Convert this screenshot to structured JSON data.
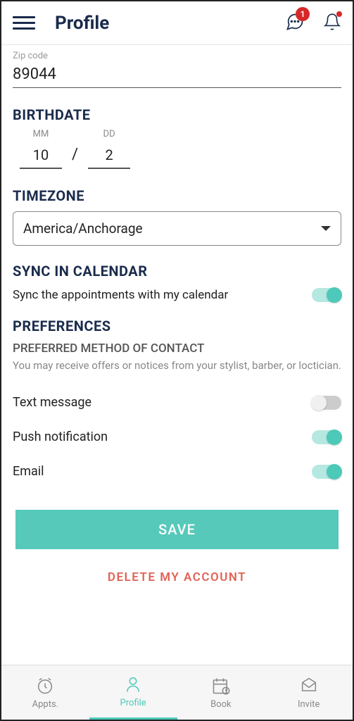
{
  "header": {
    "title": "Profile",
    "chat_badge": "1"
  },
  "zip": {
    "cut_label": "Zip code",
    "value": "89044"
  },
  "birthdate": {
    "title": "BIRTHDATE",
    "mm_label": "MM",
    "mm_value": "10",
    "dd_label": "DD",
    "dd_value": "2",
    "slash": "/"
  },
  "timezone": {
    "title": "TIMEZONE",
    "value": "America/Anchorage"
  },
  "sync": {
    "title": "SYNC IN CALENDAR",
    "text": "Sync the appointments with my calendar"
  },
  "prefs": {
    "title": "PREFERENCES",
    "subtitle": "PREFERRED METHOD OF CONTACT",
    "desc": "You may receive offers or notices from your stylist, barber, or loctician.",
    "items": [
      {
        "label": "Text message"
      },
      {
        "label": "Push notification"
      },
      {
        "label": "Email"
      }
    ]
  },
  "buttons": {
    "save": "SAVE",
    "delete": "DELETE MY ACCOUNT"
  },
  "nav": {
    "appts": "Appts.",
    "profile": "Profile",
    "book": "Book",
    "invite": "Invite"
  }
}
